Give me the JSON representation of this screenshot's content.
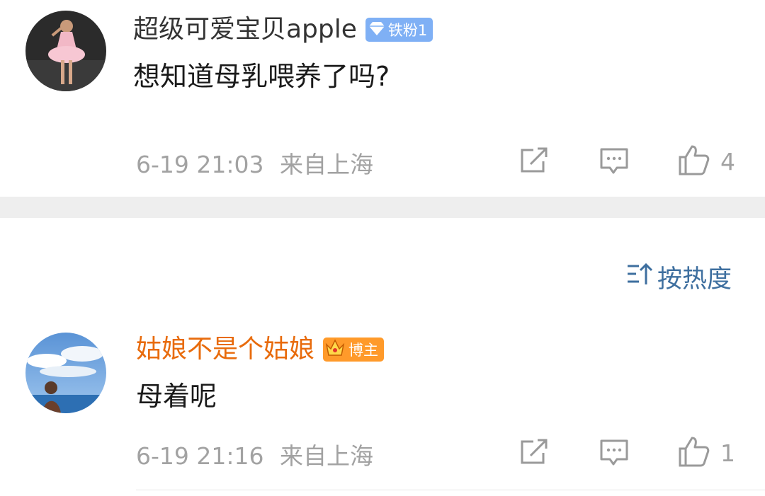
{
  "comments": [
    {
      "username": "超级可爱宝贝apple",
      "username_color": "#333333",
      "badge": "铁粉1",
      "text": "想知道母乳喂养了吗?",
      "time": "6-19 21:03",
      "location": "来自上海",
      "likes": "4"
    },
    {
      "username": "姑娘不是个姑娘",
      "username_color": "#e86b0c",
      "badge": "博主",
      "text": "母着呢",
      "time": "6-19 21:16",
      "location": "来自上海",
      "likes": "1"
    }
  ],
  "sort": {
    "label": "按热度"
  },
  "icons": [
    "share-icon",
    "comment-icon",
    "like-icon",
    "sort-icon",
    "diamond-icon",
    "crown-icon"
  ],
  "colors": {
    "link": "#3e6f9f",
    "meta": "#a2a2a2",
    "divider": "#eeeeee"
  }
}
